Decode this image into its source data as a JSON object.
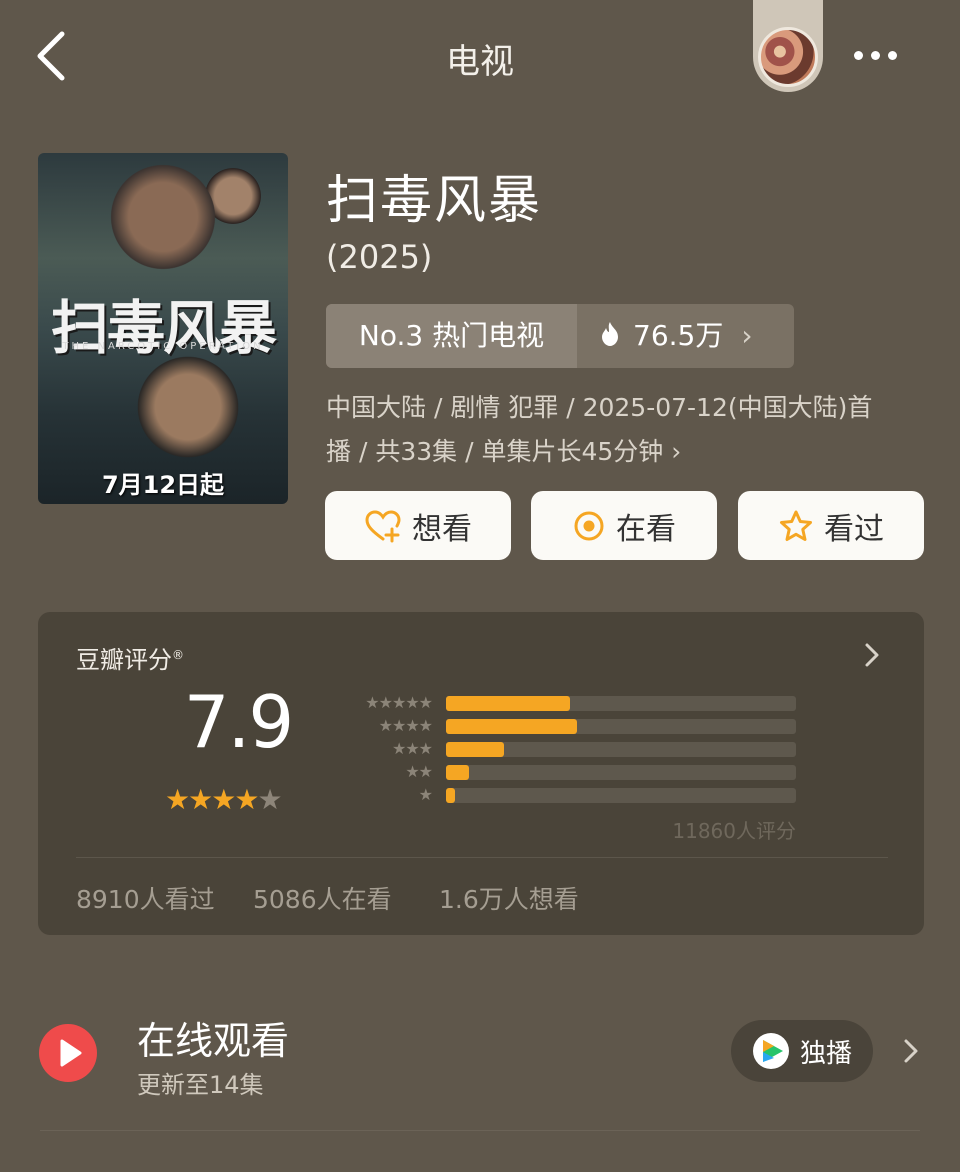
{
  "header": {
    "title": "电视",
    "back_icon": "chevron-left-icon",
    "more_icon": "more-dots-icon"
  },
  "poster": {
    "title": "扫毒风暴",
    "subtitle": "THE NARCOTIC OPERATION",
    "date": "7月12日起"
  },
  "show": {
    "title": "扫毒风暴",
    "year": "(2025)",
    "rank": "No.3 热门电视",
    "heat": "76.5万",
    "meta_line1": "中国大陆 / 剧情 犯罪 / 2025-07-12(中国大陆)首",
    "meta_line2": "播 / 共33集 / 单集片长45分钟 ›"
  },
  "actions": {
    "want": "想看",
    "watching": "在看",
    "watched": "看过"
  },
  "rating": {
    "label": "豆瓣评分",
    "mark": "®",
    "score": "7.9",
    "stars_shown": 4,
    "distribution": [
      {
        "stars": "★★★★★",
        "fraction": 0.355
      },
      {
        "stars": "★★★★",
        "fraction": 0.375
      },
      {
        "stars": "★★★",
        "fraction": 0.165
      },
      {
        "stars": "★★",
        "fraction": 0.065
      },
      {
        "stars": "★",
        "fraction": 0.025
      }
    ],
    "count": "11860人评分",
    "watched": "8910人看过",
    "watching": "5086人在看",
    "want": "1.6万人想看"
  },
  "online": {
    "title": "在线观看",
    "subtitle": "更新至14集",
    "exclusive": "独播"
  },
  "colors": {
    "background": "#5f574b",
    "accent": "#f5a623",
    "card": "#4a4439",
    "play": "#ef4b4b"
  }
}
